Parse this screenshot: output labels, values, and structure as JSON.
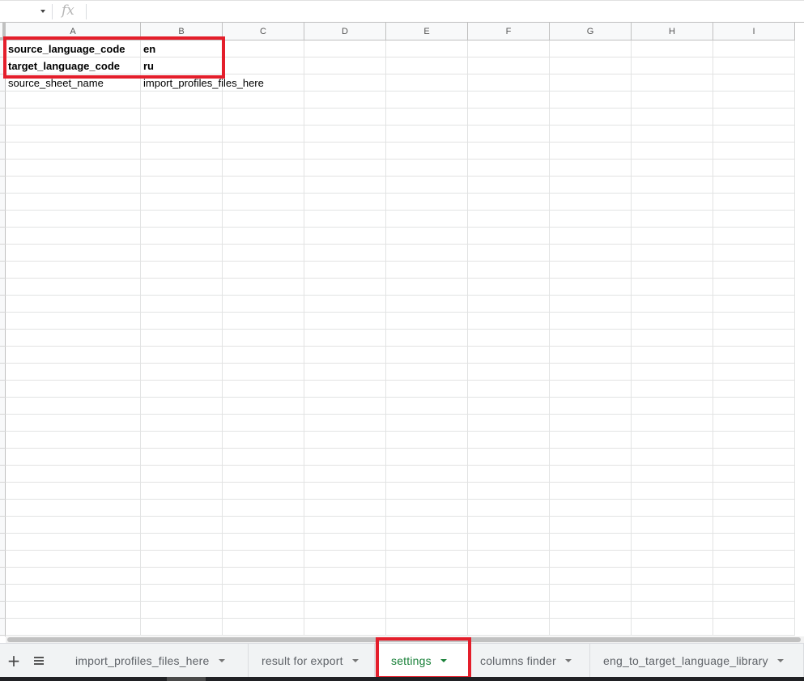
{
  "formula_bar": {
    "fx_symbol": "fx",
    "value": ""
  },
  "columns": [
    "A",
    "B",
    "C",
    "D",
    "E",
    "F",
    "G",
    "H",
    "I"
  ],
  "rows": [
    [
      "source_language_code",
      "en",
      "",
      "",
      "",
      "",
      "",
      "",
      ""
    ],
    [
      "target_language_code",
      "ru",
      "",
      "",
      "",
      "",
      "",
      "",
      ""
    ],
    [
      "source_sheet_name",
      "import_profiles_files_here",
      "",
      "",
      "",
      "",
      "",
      "",
      ""
    ]
  ],
  "bold_rows": [
    0,
    1
  ],
  "empty_row_count": 32,
  "sheet_tabs": [
    {
      "label": "import_profiles_files_here",
      "active": false
    },
    {
      "label": "result for export",
      "active": false
    },
    {
      "label": "settings",
      "active": true
    },
    {
      "label": "columns finder",
      "active": false
    },
    {
      "label": "eng_to_target_language_library",
      "active": false
    }
  ],
  "colors": {
    "highlight": "#e41e2b",
    "active_tab_text": "#188038",
    "grid_line": "#e2e3e3"
  },
  "icons": {
    "add_sheet": "plus-icon",
    "all_sheets": "list-icon",
    "name_box_dropdown": "chevron-down-icon",
    "formula": "fx-icon"
  }
}
